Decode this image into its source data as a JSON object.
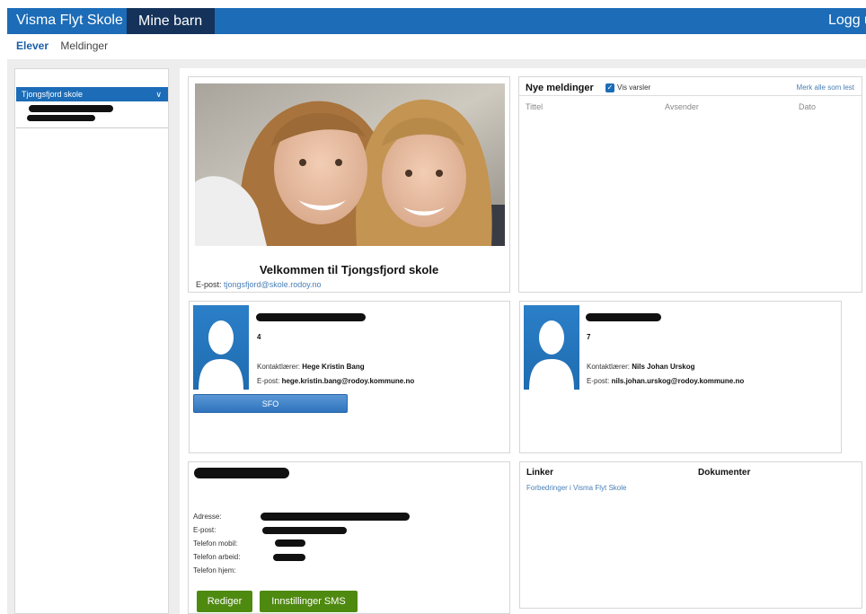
{
  "header": {
    "brand": "Visma Flyt Skole",
    "active_tab": "Mine barn",
    "logout": "Logg ut"
  },
  "subnav": {
    "items": [
      "Elever",
      "Meldinger"
    ]
  },
  "sidebar": {
    "school_select": "Tjongsfjord skole"
  },
  "welcome": {
    "title": "Velkommen til Tjongsfjord skole",
    "email_label": "E-post:",
    "email_value": "tjongsfjord@skole.rodoy.no"
  },
  "messages": {
    "title": "Nye meldinger",
    "show_alerts_label": "Vis varsler",
    "show_alerts_checked": true,
    "mark_all": "Merk alle som lest",
    "columns": [
      "Tittel",
      "Avsender",
      "Dato"
    ]
  },
  "children": [
    {
      "grade": "4",
      "teacher_label": "Kontaktlærer:",
      "teacher_name": "Hege Kristin Bang",
      "email_label": "E-post:",
      "email": "hege.kristin.bang@rodoy.kommune.no",
      "button": "SFO"
    },
    {
      "grade": "7",
      "teacher_label": "Kontaktlærer:",
      "teacher_name": "Nils Johan Urskog",
      "email_label": "E-post:",
      "email": "nils.johan.urskog@rodoy.kommune.no"
    }
  ],
  "contact": {
    "labels": [
      "Adresse:",
      "E-post:",
      "Telefon mobil:",
      "Telefon arbeid:",
      "Telefon hjem:"
    ],
    "edit_button": "Rediger",
    "sms_button": "Innstillinger SMS"
  },
  "links": {
    "links_title": "Linker",
    "documents_title": "Dokumenter",
    "link_1": "Forbedringer i Visma Flyt Skole"
  },
  "colors": {
    "brand_blue": "#1c6cb7",
    "active_tab": "#14325a",
    "green_button": "#4f8a10"
  }
}
